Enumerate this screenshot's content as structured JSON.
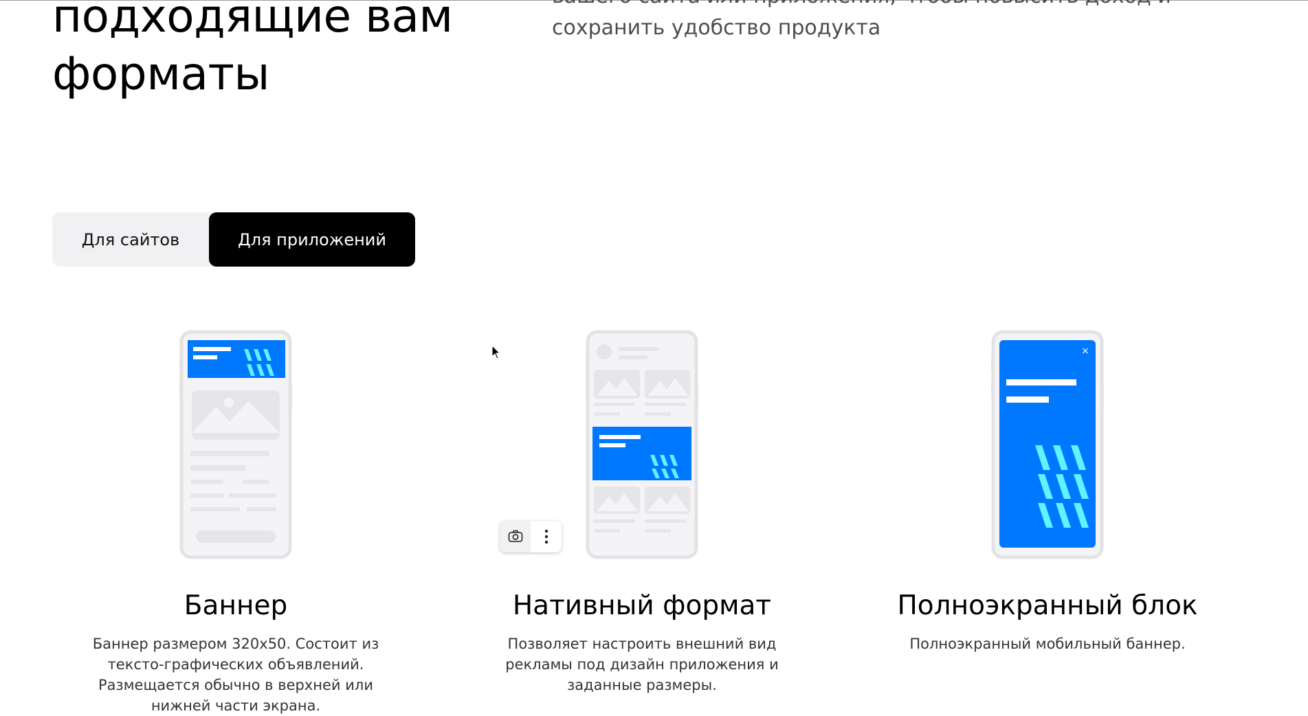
{
  "hero": {
    "title_lines": [
      "подходящие вам",
      "форматы"
    ],
    "subtitle_lines": [
      "вашего сайта или приложения, чтобы повысить доход и",
      "сохранить удобство продукта"
    ]
  },
  "tabs": [
    {
      "label": "Для сайтов",
      "active": false
    },
    {
      "label": "Для приложений",
      "active": true
    }
  ],
  "formats": [
    {
      "title": "Баннер",
      "description": "Баннер размером 320x50. Состоит из тексто-графических объявлений. Размещается обычно в верхней или нижней части экрана.",
      "illustration": "phone-banner-icon"
    },
    {
      "title": "Нативный формат",
      "description": "Позволяет настроить внешний вид рекламы под дизайн приложения и заданные размеры.",
      "illustration": "phone-native-icon"
    },
    {
      "title": "Полноэкранный блок",
      "description": "Полноэкранный мобильный баннер.",
      "illustration": "phone-fullscreen-icon"
    }
  ],
  "fullscreen_close_glyph": "×",
  "context_toolbar": {
    "icons": [
      "camera-icon",
      "more-vertical-icon"
    ]
  },
  "colors": {
    "accent_blue": "#0077ff",
    "wave_cyan": "#5ff2ff",
    "tab_active_bg": "#000000",
    "tab_bg": "#f1f1f3",
    "phone_frame": "#e3e3e6"
  }
}
